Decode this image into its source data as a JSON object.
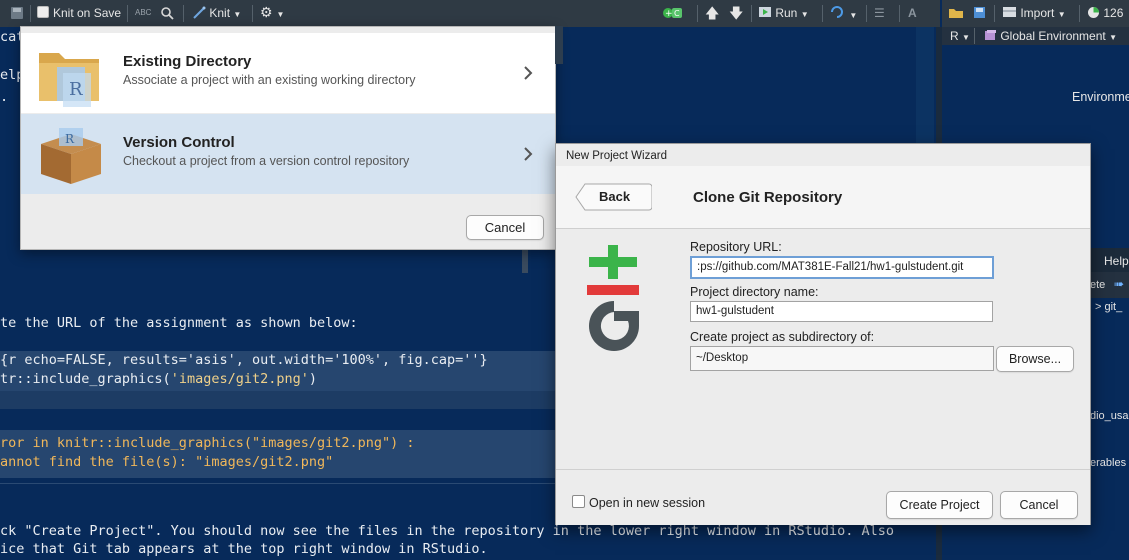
{
  "toolbar": {
    "knit_on_save": "Knit on Save",
    "knit": "Knit",
    "run": "Run",
    "import": "Import",
    "memory": "126"
  },
  "env": {
    "r_label": "R",
    "global_env": "Global Environment",
    "pane_label": "Environme"
  },
  "right_fragments": {
    "help_tab": "Help",
    "ete": "ete",
    "git": "git_",
    "dio": "dio_usa",
    "erables": "erables"
  },
  "editor": {
    "line1": "cat",
    "line2": "elp",
    "line3": ".",
    "line4": "te the URL of the assignment as shown below:",
    "chunk_header": "{r echo=FALSE, results='asis', out.width='100%', fig.cap=''}",
    "chunk_call_prefix": "tr::include_graphics(",
    "chunk_call_arg": "'images/git2.png'",
    "chunk_call_suffix": ")",
    "error_line1": "ror in knitr::include_graphics(\"images/git2.png\") :",
    "error_line2": "annot find the file(s): \"images/git2.png\"",
    "footer_line1": "ck \"Create Project\". You should now see the files in the repository in the lower right window in RStudio. Also",
    "footer_line2": "ice that Git tab appears at the top right window in RStudio."
  },
  "project_popup": {
    "existing_title": "Existing Directory",
    "existing_desc": "Associate a project with an existing working directory",
    "vc_title": "Version Control",
    "vc_desc": "Checkout a project from a version control repository",
    "cancel": "Cancel"
  },
  "wizard": {
    "window_title": "New Project Wizard",
    "back": "Back",
    "heading": "Clone Git Repository",
    "repo_url_label": "Repository URL:",
    "repo_url_value": ":ps://github.com/MAT381E-Fall21/hw1-gulstudent.git",
    "dir_name_label": "Project directory name:",
    "dir_name_value": "hw1-gulstudent",
    "subdir_label": "Create project as subdirectory of:",
    "subdir_value": "~/Desktop",
    "browse": "Browse...",
    "open_new_session": "Open in new session",
    "create_project": "Create Project",
    "cancel": "Cancel"
  },
  "colors": {
    "editor_bg": "#072a5a",
    "git_green": "#3bb44a",
    "git_red": "#e23a3a",
    "git_gray": "#4a5358"
  },
  "icons": [
    "save-icon",
    "spellcheck-icon",
    "search-icon",
    "knit-icon",
    "gear-icon",
    "add-chunk-icon",
    "up-arrow-icon",
    "down-arrow-icon",
    "run-icon",
    "rerun-icon",
    "outline-icon",
    "format-icon",
    "broom-icon",
    "import-icon",
    "memory-icon",
    "folder-icon",
    "package-box-icon",
    "chevron-right-icon",
    "git-logo-icon"
  ]
}
